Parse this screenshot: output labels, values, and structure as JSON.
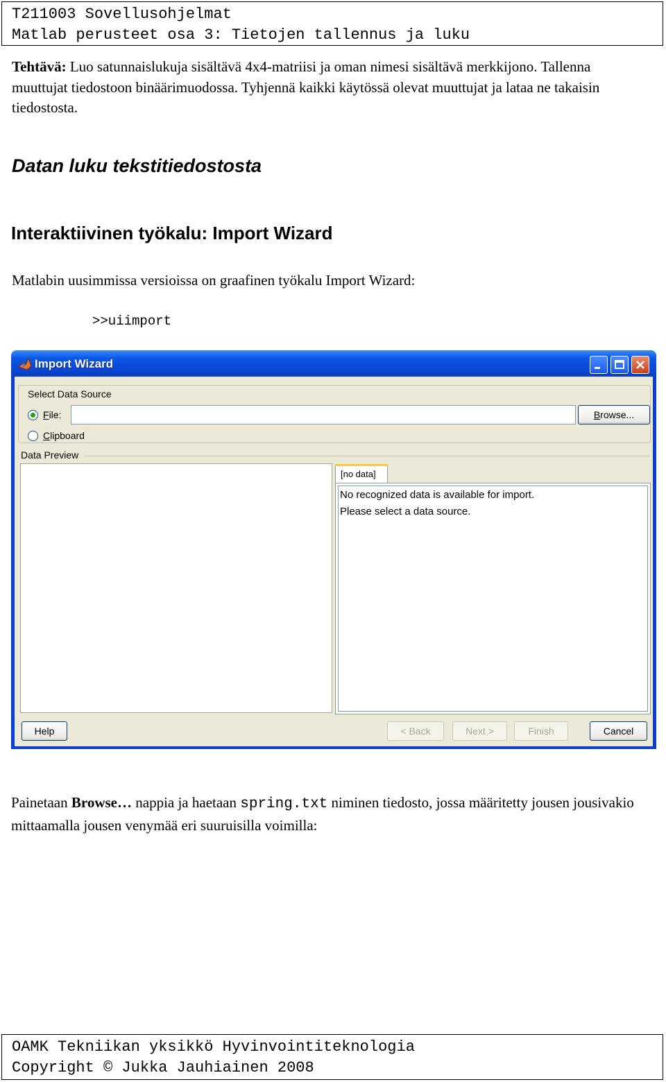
{
  "header": {
    "line1": "T211003 Sovellusohjelmat",
    "line2": "Matlab perusteet osa 3: Tietojen tallennus ja luku"
  },
  "task": {
    "label": "Tehtävä:",
    "text": " Luo satunnaislukuja sisältävä 4x4-matriisi ja oman nimesi sisältävä merkkijono. Tallenna muuttujat tiedostoon binäärimuodossa. Tyhjennä kaikki käytössä olevat muuttujat ja lataa ne takaisin tiedostosta."
  },
  "section_heading": "Datan luku tekstitiedostosta",
  "subheading": "Interaktiivinen työkalu: Import Wizard",
  "intro": "Matlabin uusimmissa versioissa on graafinen työkalu Import Wizard:",
  "command": ">>uiimport",
  "wizard": {
    "title": "Import Wizard",
    "select_source_label": "Select Data Source",
    "file_option": {
      "accel": "F",
      "rest": "ile:"
    },
    "clipboard_option": {
      "accel": "C",
      "rest": "lipboard"
    },
    "file_value": "",
    "browse": {
      "accel": "B",
      "rest": "rowse..."
    },
    "preview_label": "Data Preview",
    "tab_label": "[no data]",
    "message_line1": "No recognized data is available for import.",
    "message_line2": "Please select a data source.",
    "help": "Help",
    "back": "< Back",
    "next": "Next >",
    "finish": "Finish",
    "cancel": "Cancel"
  },
  "paragraph": {
    "part1": "Painetaan ",
    "bold": "Browse…",
    "part2": " nappia ja haetaan ",
    "code": "spring.txt",
    "part3": " niminen tiedosto, jossa määritetty jousen jousivakio mittaamalla jousen venymää eri suuruisilla voimilla:"
  },
  "footer": {
    "line1": "OAMK Tekniikan yksikkö Hyvinvointiteknologia",
    "line2": "Copyright © Jukka Jauhiainen 2008"
  },
  "colors": {
    "titlebar": "#0b58e5",
    "window_bg": "#ece9d8",
    "close_button": "#c9421c"
  },
  "icons": [
    "matlab-logo-icon",
    "minimize-icon",
    "maximize-icon",
    "close-icon"
  ]
}
